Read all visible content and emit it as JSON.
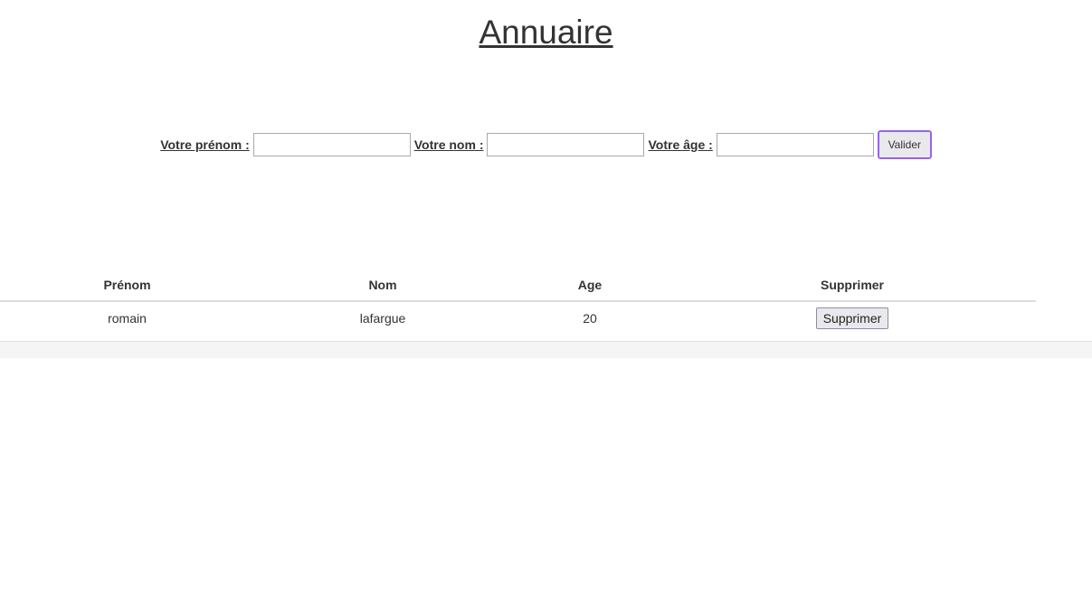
{
  "header": {
    "title": "Annuaire"
  },
  "form": {
    "first_name_label": "Votre prénom :",
    "first_name_value": "",
    "last_name_label": "Votre nom :",
    "last_name_value": "",
    "age_label": "Votre âge :",
    "age_value": "",
    "submit_label": "Valider",
    "submit_border_color": "#9466e8"
  },
  "table": {
    "columns": [
      "Prénom",
      "Nom",
      "Age",
      "Supprimer"
    ],
    "rows": [
      {
        "first_name": "romain",
        "last_name": "lafargue",
        "age": "20",
        "delete_label": "Supprimer"
      }
    ]
  }
}
